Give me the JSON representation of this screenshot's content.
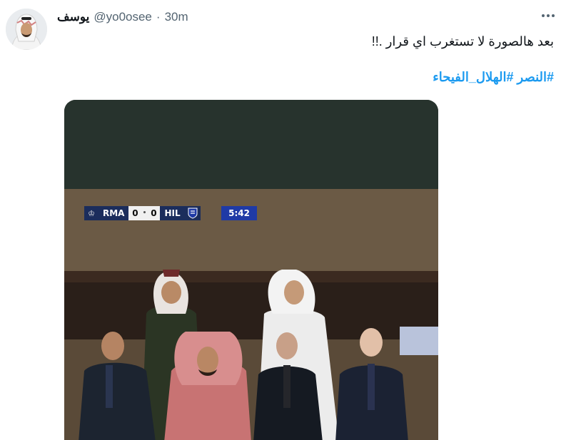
{
  "tweet": {
    "author_name": "يوسف",
    "handle": "@yo0osee",
    "separator": "·",
    "time": "30m",
    "text": "بعد هالصورة لا تستغرب اي قرار .!!",
    "hashtags": [
      "#النصر",
      "#الهلال_الفيحاء"
    ]
  },
  "scoreboard": {
    "home_team": "RMA",
    "home_score": "0",
    "away_score": "0",
    "away_team": "HIL",
    "clock": "5:42"
  },
  "colors": {
    "link": "#1d9bf0",
    "text": "#0f1419",
    "muted": "#536471",
    "scorebug_navy": "#1b2d5c",
    "scorebug_clock": "#1f3aa6"
  },
  "icons": {
    "more": "more-options-icon",
    "crest_home": "real-madrid-crest-icon",
    "crest_away": "al-hilal-crest-icon"
  }
}
